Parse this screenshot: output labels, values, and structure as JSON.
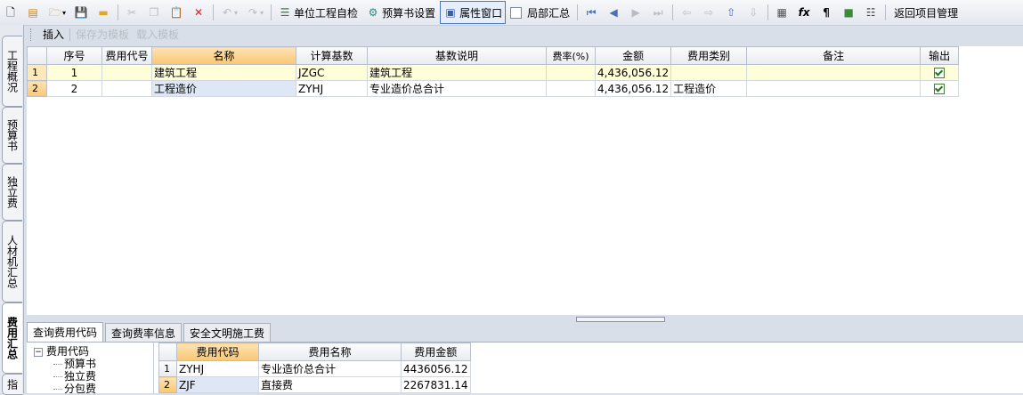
{
  "toolbar": {
    "unit_check": "单位工程自检",
    "budget_settings": "预算书设置",
    "property_window": "属性窗口",
    "partial_summary": "局部汇总",
    "return_project": "返回项目管理",
    "fx_label": "fx",
    "para_label": "¶"
  },
  "subbar": {
    "insert": "插入",
    "save_template": "保存为模板",
    "load_template": "载入模板"
  },
  "sidebar": {
    "tabs": [
      "工程概况",
      "预算书",
      "独立费",
      "人材机汇总",
      "费用汇总",
      "指"
    ]
  },
  "main_grid": {
    "columns": [
      "序号",
      "费用代号",
      "名称",
      "计算基数",
      "基数说明",
      "费率(%)",
      "金额",
      "费用类别",
      "备注",
      "输出"
    ],
    "rows": [
      {
        "rownum": "1",
        "seq": "1",
        "code": "",
        "name": "建筑工程",
        "base": "JZGC",
        "base_desc": "建筑工程",
        "rate": "",
        "amount": "4,436,056.12",
        "category": "",
        "remark": "",
        "output": true
      },
      {
        "rownum": "2",
        "seq": "2",
        "code": "",
        "name": "工程造价",
        "base": "ZYHJ",
        "base_desc": "专业造价总合计",
        "rate": "",
        "amount": "4,436,056.12",
        "category": "工程造价",
        "remark": "",
        "output": true
      }
    ]
  },
  "bottom_tabs": [
    "查询费用代码",
    "查询费率信息",
    "安全文明施工费"
  ],
  "tree": {
    "root": "费用代码",
    "children": [
      "预算书",
      "独立费",
      "分包费"
    ]
  },
  "code_grid": {
    "columns": [
      "费用代码",
      "费用名称",
      "费用金额"
    ],
    "rows": [
      {
        "rownum": "1",
        "code": "ZYHJ",
        "name": "专业造价总合计",
        "amount": "4436056.12"
      },
      {
        "rownum": "2",
        "code": "ZJF",
        "name": "直接费",
        "amount": "2267831.14"
      }
    ]
  }
}
